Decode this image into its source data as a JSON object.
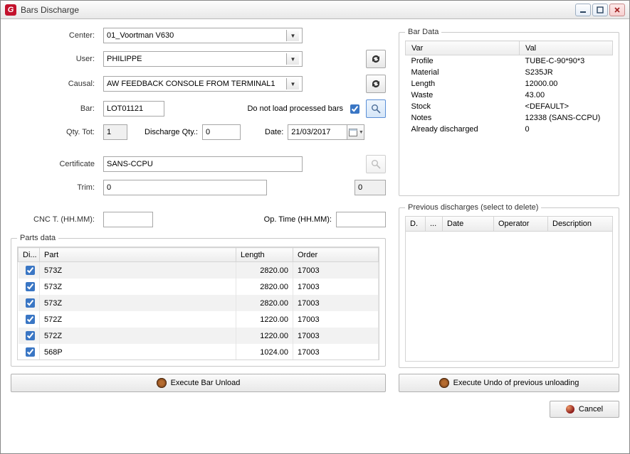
{
  "window": {
    "title": "Bars Discharge"
  },
  "form": {
    "labels": {
      "center": "Center:",
      "user": "User:",
      "causal": "Causal:",
      "bar": "Bar:",
      "processed": "Do not load processed bars",
      "qty_tot": "Qty. Tot:",
      "discharge_qty": "Discharge Qty.:",
      "date": "Date:",
      "certificate": "Certificate",
      "trim": "Trim:",
      "cnc_t": "CNC T. (HH.MM):",
      "op_time": "Op. Time (HH.MM):"
    },
    "values": {
      "center": "01_Voortman V630",
      "user": "PHILIPPE",
      "causal": "AW FEEDBACK CONSOLE FROM TERMINAL1",
      "bar": "LOT01121",
      "qty_tot": "1",
      "discharge_qty": "0",
      "date": "21/03/2017",
      "certificate": "SANS-CCPU",
      "trim": "0",
      "trim2": "0",
      "cnc_t": "",
      "op_time": ""
    }
  },
  "bar_data": {
    "title": "Bar Data",
    "headers": {
      "var": "Var",
      "val": "Val"
    },
    "rows": [
      {
        "var": "Profile",
        "val": "TUBE-C-90*90*3"
      },
      {
        "var": "Material",
        "val": "S235JR"
      },
      {
        "var": "Length",
        "val": "12000.00"
      },
      {
        "var": "Waste",
        "val": "43.00"
      },
      {
        "var": "Stock",
        "val": "<DEFAULT>"
      },
      {
        "var": "Notes",
        "val": "12338 (SANS-CCPU)"
      },
      {
        "var": "Already discharged",
        "val": "0"
      }
    ]
  },
  "prev": {
    "title": "Previous discharges (select to delete)",
    "headers": {
      "d": "D.",
      "dots": "...",
      "date": "Date",
      "operator": "Operator",
      "desc": "Description"
    }
  },
  "parts": {
    "title": "Parts data",
    "headers": {
      "di": "Di...",
      "part": "Part",
      "length": "Length",
      "order": "Order"
    },
    "rows": [
      {
        "chk": true,
        "part": "573Z",
        "length": "2820.00",
        "order": "17003"
      },
      {
        "chk": true,
        "part": "573Z",
        "length": "2820.00",
        "order": "17003"
      },
      {
        "chk": true,
        "part": "573Z",
        "length": "2820.00",
        "order": "17003"
      },
      {
        "chk": true,
        "part": "572Z",
        "length": "1220.00",
        "order": "17003"
      },
      {
        "chk": true,
        "part": "572Z",
        "length": "1220.00",
        "order": "17003"
      },
      {
        "chk": true,
        "part": "568P",
        "length": "1024.00",
        "order": "17003"
      }
    ]
  },
  "buttons": {
    "exec_unload": "Execute Bar Unload",
    "exec_undo": "Execute Undo of previous unloading",
    "cancel": "Cancel"
  }
}
